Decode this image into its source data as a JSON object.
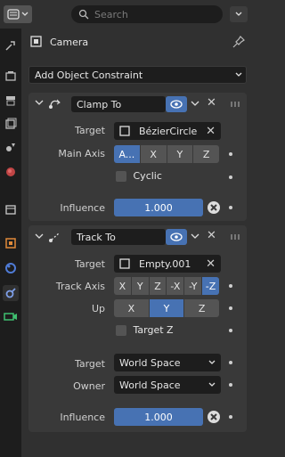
{
  "header": {
    "search_placeholder": "Search",
    "object_name": "Camera"
  },
  "add_constraint_label": "Add Object Constraint",
  "clamp": {
    "name": "Clamp To",
    "target_label": "Target",
    "target_value": "BézierCircle",
    "main_axis_label": "Main Axis",
    "main_axis_options": [
      "A...",
      "X",
      "Y",
      "Z"
    ],
    "main_axis_selected": "A...",
    "cyclic_label": "Cyclic",
    "influence_label": "Influence",
    "influence_value": "1.000"
  },
  "track": {
    "name": "Track To",
    "target_label": "Target",
    "target_value": "Empty.001",
    "track_axis_label": "Track Axis",
    "track_axis_options": [
      "X",
      "Y",
      "Z",
      "-X",
      "-Y",
      "-Z"
    ],
    "track_axis_selected": "-Z",
    "up_label": "Up",
    "up_options": [
      "X",
      "Y",
      "Z"
    ],
    "up_selected": "Y",
    "target_z_label": "Target Z",
    "target_space_label": "Target",
    "target_space_value": "World Space",
    "owner_space_label": "Owner",
    "owner_space_value": "World Space",
    "influence_label": "Influence",
    "influence_value": "1.000"
  },
  "colors": {
    "accent": "#4772b3",
    "panel": "#393939",
    "field": "#1d1d1d",
    "background": "#303030"
  },
  "sidebar_icons": [
    "tool-icon",
    "render-icon",
    "output-icon",
    "view-layer-icon",
    "scene-icon",
    "world-icon",
    "collection-icon",
    "object-icon",
    "modifier-icon",
    "constraint-icon",
    "data-icon"
  ]
}
